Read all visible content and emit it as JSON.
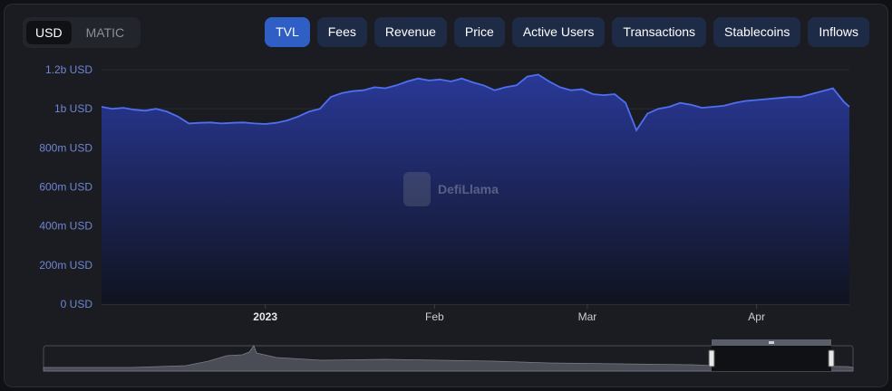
{
  "denomination": {
    "options": [
      "USD",
      "MATIC"
    ],
    "selected": "USD"
  },
  "tabs": [
    {
      "label": "TVL",
      "active": true
    },
    {
      "label": "Fees",
      "active": false
    },
    {
      "label": "Revenue",
      "active": false
    },
    {
      "label": "Price",
      "active": false
    },
    {
      "label": "Active Users",
      "active": false
    },
    {
      "label": "Transactions",
      "active": false
    },
    {
      "label": "Stablecoins",
      "active": false
    },
    {
      "label": "Inflows",
      "active": false
    }
  ],
  "watermark": "DefiLlama",
  "colors": {
    "line": "#4f6ff0",
    "fill_top": "#2a3a9e",
    "fill_bottom": "#0f1220",
    "active_tab": "#2f5ec4",
    "tab": "#1e2b47"
  },
  "chart_data": {
    "type": "area",
    "title": "",
    "xlabel": "",
    "ylabel": "",
    "ylim": [
      0,
      1200000000
    ],
    "y_ticks": [
      0,
      200000000,
      400000000,
      600000000,
      800000000,
      1000000000,
      1200000000
    ],
    "y_tick_labels": [
      "0 USD",
      "200m USD",
      "400m USD",
      "600m USD",
      "800m USD",
      "1b USD",
      "1.2b USD"
    ],
    "x_tick_labels": [
      {
        "date": "2023-01-01",
        "label": "2023",
        "bold": true
      },
      {
        "date": "2023-02-01",
        "label": "Feb",
        "bold": false
      },
      {
        "date": "2023-03-01",
        "label": "Mar",
        "bold": false
      },
      {
        "date": "2023-04-01",
        "label": "Apr",
        "bold": false
      }
    ],
    "x_range": [
      "2022-12-02",
      "2023-04-18"
    ],
    "grid": true,
    "legend": "none",
    "series": [
      {
        "x": [
          "2022-12-02",
          "2022-12-04",
          "2022-12-06",
          "2022-12-08",
          "2022-12-10",
          "2022-12-12",
          "2022-12-14",
          "2022-12-16",
          "2022-12-18",
          "2022-12-20",
          "2022-12-22",
          "2022-12-24",
          "2022-12-26",
          "2022-12-28",
          "2022-12-30",
          "2023-01-01",
          "2023-01-03",
          "2023-01-05",
          "2023-01-07",
          "2023-01-09",
          "2023-01-11",
          "2023-01-13",
          "2023-01-15",
          "2023-01-17",
          "2023-01-19",
          "2023-01-21",
          "2023-01-23",
          "2023-01-25",
          "2023-01-27",
          "2023-01-29",
          "2023-01-31",
          "2023-02-02",
          "2023-02-04",
          "2023-02-06",
          "2023-02-08",
          "2023-02-10",
          "2023-02-12",
          "2023-02-14",
          "2023-02-16",
          "2023-02-18",
          "2023-02-20",
          "2023-02-22",
          "2023-02-24",
          "2023-02-26",
          "2023-02-28",
          "2023-03-02",
          "2023-03-04",
          "2023-03-06",
          "2023-03-08",
          "2023-03-10",
          "2023-03-12",
          "2023-03-14",
          "2023-03-16",
          "2023-03-18",
          "2023-03-20",
          "2023-03-22",
          "2023-03-24",
          "2023-03-26",
          "2023-03-28",
          "2023-03-30",
          "2023-04-01",
          "2023-04-03",
          "2023-04-05",
          "2023-04-07",
          "2023-04-09",
          "2023-04-11",
          "2023-04-13",
          "2023-04-15",
          "2023-04-17",
          "2023-04-18"
        ],
        "values": [
          1010000000,
          1000000000,
          1005000000,
          995000000,
          990000000,
          1000000000,
          985000000,
          960000000,
          925000000,
          928000000,
          930000000,
          925000000,
          928000000,
          930000000,
          925000000,
          922000000,
          928000000,
          940000000,
          960000000,
          985000000,
          1000000000,
          1060000000,
          1080000000,
          1090000000,
          1095000000,
          1110000000,
          1105000000,
          1120000000,
          1140000000,
          1155000000,
          1145000000,
          1150000000,
          1140000000,
          1155000000,
          1135000000,
          1120000000,
          1095000000,
          1110000000,
          1120000000,
          1165000000,
          1175000000,
          1140000000,
          1110000000,
          1095000000,
          1100000000,
          1075000000,
          1070000000,
          1075000000,
          1030000000,
          890000000,
          975000000,
          1000000000,
          1010000000,
          1030000000,
          1020000000,
          1005000000,
          1010000000,
          1015000000,
          1030000000,
          1040000000,
          1045000000,
          1050000000,
          1055000000,
          1060000000,
          1060000000,
          1075000000,
          1090000000,
          1105000000,
          1035000000,
          1010000000
        ]
      }
    ]
  }
}
